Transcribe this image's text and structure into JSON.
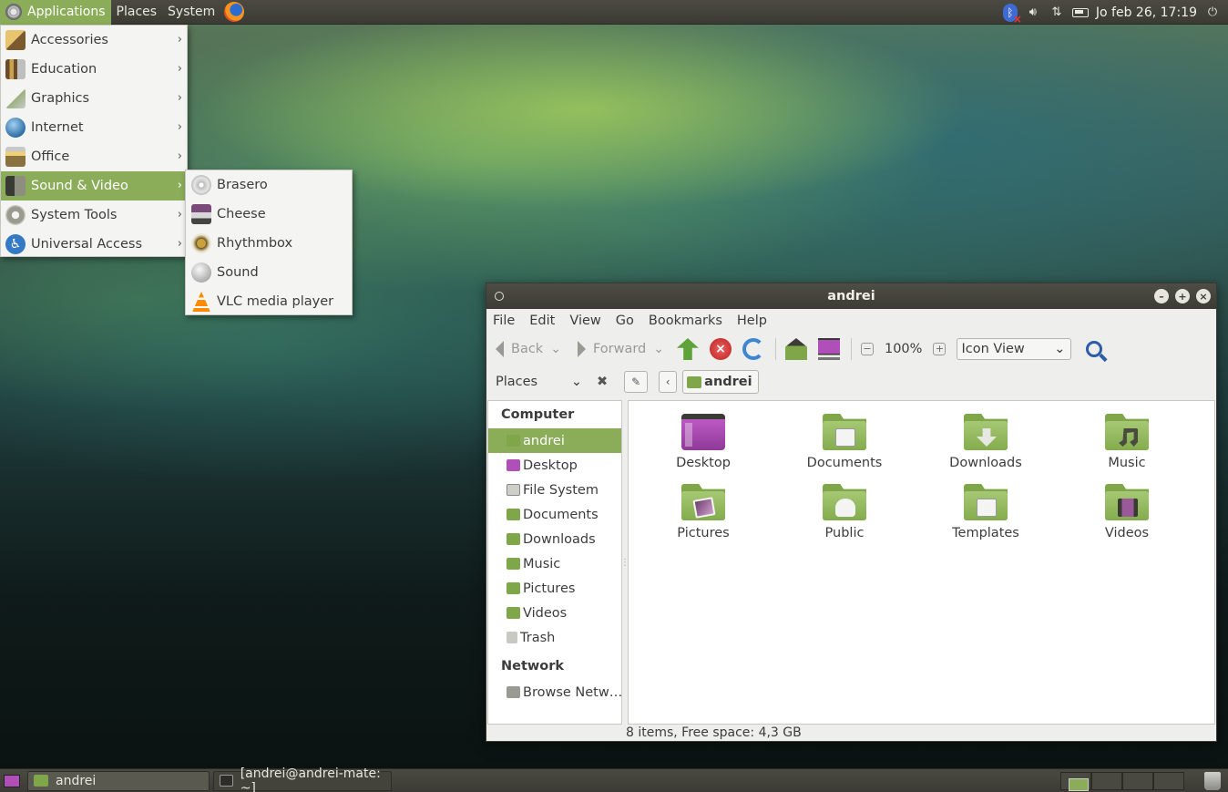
{
  "top_panel": {
    "menus": [
      "Applications",
      "Places",
      "System"
    ],
    "clock": "Jo feb 26, 17:19"
  },
  "app_menu": {
    "items": [
      {
        "label": "Accessories"
      },
      {
        "label": "Education"
      },
      {
        "label": "Graphics"
      },
      {
        "label": "Internet"
      },
      {
        "label": "Office"
      },
      {
        "label": "Sound & Video"
      },
      {
        "label": "System Tools"
      },
      {
        "label": "Universal Access"
      }
    ],
    "active_item": "Sound & Video"
  },
  "sub_menu": {
    "items": [
      {
        "label": "Brasero"
      },
      {
        "label": "Cheese"
      },
      {
        "label": "Rhythmbox"
      },
      {
        "label": "Sound"
      },
      {
        "label": "VLC media player"
      }
    ]
  },
  "file_manager": {
    "title": "andrei",
    "menubar": [
      "File",
      "Edit",
      "View",
      "Go",
      "Bookmarks",
      "Help"
    ],
    "toolbar": {
      "back": "Back",
      "forward": "Forward",
      "zoom": "100%",
      "view_mode": "Icon View"
    },
    "location": {
      "places_label": "Places",
      "crumb": "andrei"
    },
    "sidebar": {
      "computer_heading": "Computer",
      "computer_items": [
        "andrei",
        "Desktop",
        "File System",
        "Documents",
        "Downloads",
        "Music",
        "Pictures",
        "Videos",
        "Trash"
      ],
      "network_heading": "Network",
      "network_items": [
        "Browse Netw…"
      ]
    },
    "files": [
      "Desktop",
      "Documents",
      "Downloads",
      "Music",
      "Pictures",
      "Public",
      "Templates",
      "Videos"
    ],
    "status": "8 items, Free space: 4,3 GB"
  },
  "bottom_panel": {
    "tasks": [
      "andrei",
      "[andrei@andrei-mate: ~]"
    ]
  },
  "colors": {
    "accent": "#8bad5a",
    "panel": "#3f3e38",
    "folder": "#7fa74a"
  }
}
